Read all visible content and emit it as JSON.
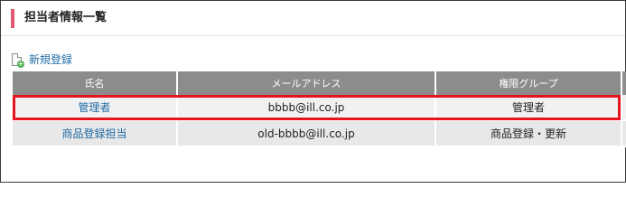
{
  "header": {
    "title": "担当者情報一覧"
  },
  "actions": {
    "new_label": "新規登録"
  },
  "table": {
    "columns": [
      "氏名",
      "メールアドレス",
      "権限グループ"
    ],
    "rows": [
      {
        "name": "管理者",
        "email": "bbbb@ill.co.jp",
        "group": "管理者"
      },
      {
        "name": "商品登録担当",
        "email": "old-bbbb@ill.co.jp",
        "group": "商品登録・更新"
      }
    ]
  },
  "colors": {
    "accent": "#e05a73",
    "header_bg": "#8c8c8c",
    "link": "#1f6aa5",
    "highlight": "#e4151f"
  },
  "icons": {
    "new": "new-document-icon"
  }
}
